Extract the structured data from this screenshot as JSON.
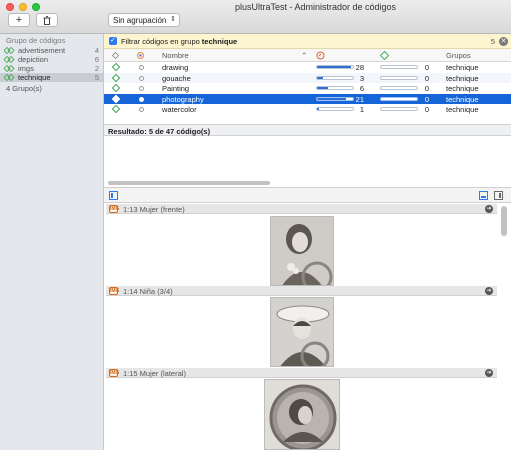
{
  "window": {
    "title": "plusUltraTest - Administrador de códigos"
  },
  "toolbar": {
    "add_label": "+",
    "delete_icon": "trash-icon",
    "grouping_value": "Sin agrupación"
  },
  "sidebar": {
    "header": "Grupo de códigos",
    "groups": [
      {
        "name": "advertisement",
        "count": "4"
      },
      {
        "name": "depiction",
        "count": "6"
      },
      {
        "name": "imgs",
        "count": "2"
      },
      {
        "name": "technique",
        "count": "5"
      }
    ],
    "footer": "4 Grupo(s)"
  },
  "filter": {
    "prefix": "Filtrar códigos en grupo",
    "group": "technique",
    "count": "5"
  },
  "table": {
    "headers": {
      "name": "Nombre",
      "groups": "Grupos"
    },
    "rows": [
      {
        "name": "drawing",
        "quotations": "28",
        "links": "0",
        "group": "technique",
        "q_fill": 0.95
      },
      {
        "name": "gouache",
        "quotations": "3",
        "links": "0",
        "group": "technique",
        "q_fill": 0.18
      },
      {
        "name": "Painting",
        "quotations": "6",
        "links": "0",
        "group": "technique",
        "q_fill": 0.3
      },
      {
        "name": "photography",
        "quotations": "21",
        "links": "0",
        "group": "technique",
        "q_fill": 0.8
      },
      {
        "name": "watercolor",
        "quotations": "1",
        "links": "0",
        "group": "technique",
        "q_fill": 0.05
      }
    ],
    "result": "Resultado: 5 de 47 código(s)"
  },
  "quotations": [
    {
      "label": "1:13 Mujer (frente)"
    },
    {
      "label": "1:14 Niña (3/4)"
    },
    {
      "label": "1:15 Mujer (lateral)"
    }
  ],
  "colors": {
    "accent": "#1665d8",
    "code_green": "#3aa64c",
    "filter_bg": "#fdf4d0"
  }
}
